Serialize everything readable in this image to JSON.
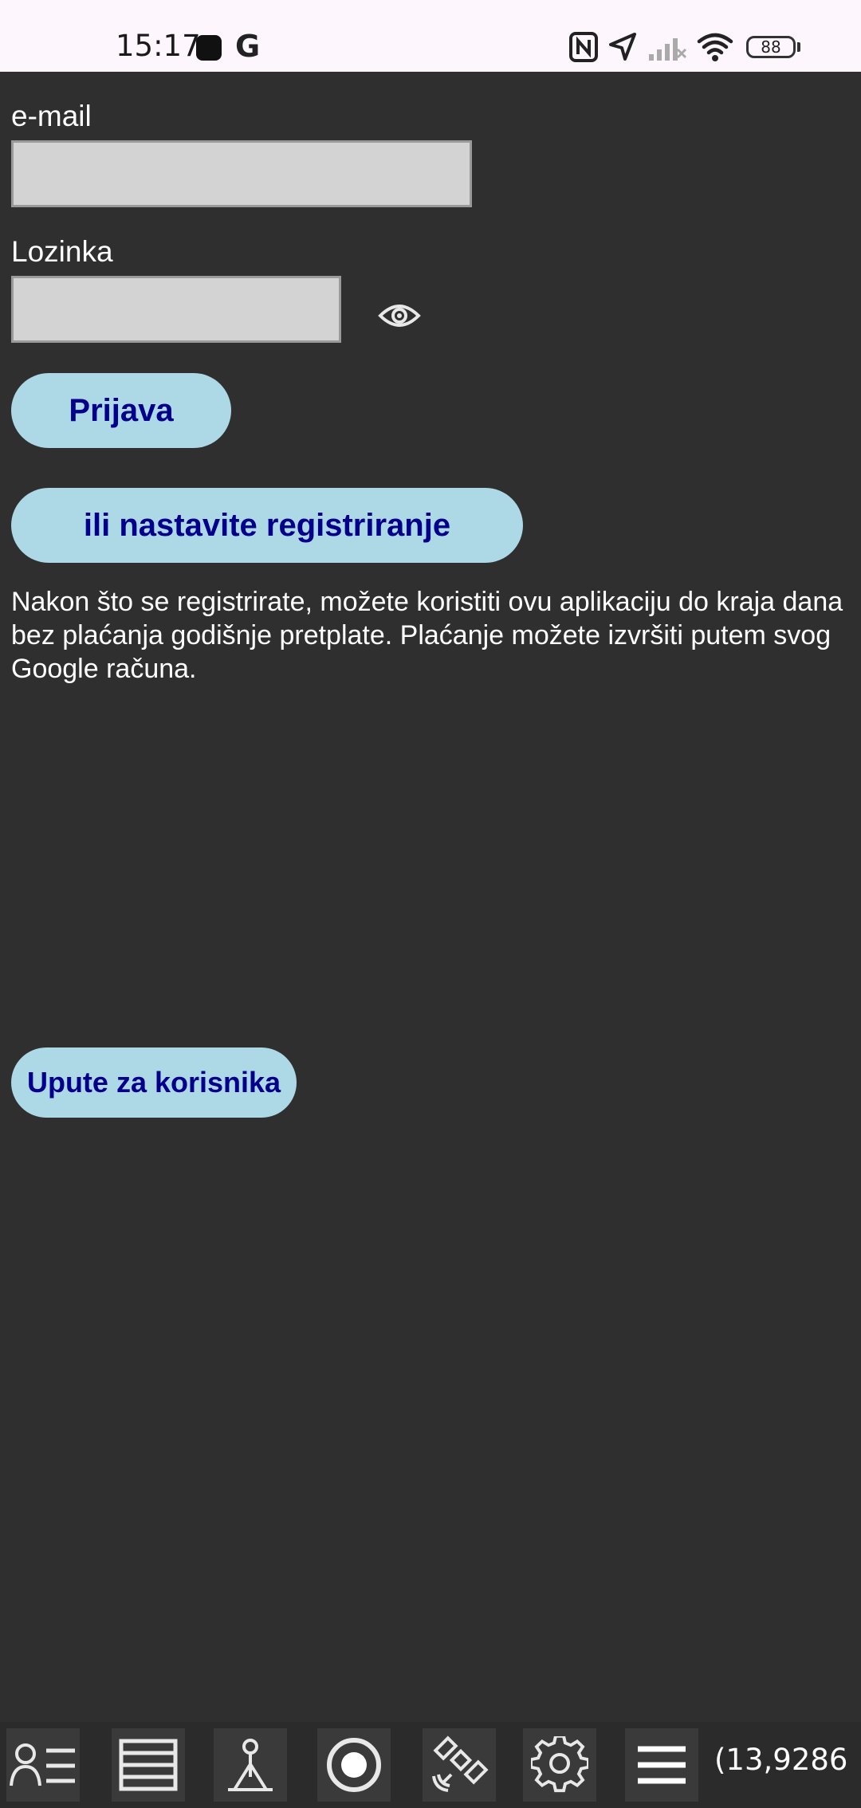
{
  "status_bar": {
    "time": "15:17",
    "g_glyph": "G",
    "battery": "88",
    "icons": [
      "nfc-icon",
      "location-arrow-icon",
      "signal-off-icon",
      "wifi-icon",
      "battery-icon"
    ]
  },
  "form": {
    "email_label": "e-mail",
    "email_value": "",
    "password_label": "Lozinka",
    "password_value": "",
    "login_button": "Prijava",
    "register_button": "ili nastavite registriranje",
    "info": "Nakon što se registrirate, možete koristiti ovu aplikaciju do kraja dana bez plaćanja godišnje pretplate. Plaćanje možete izvršiti putem svog Google računa.",
    "manual_button": "Upute za korisnika"
  },
  "toolbar": {
    "icons": [
      "user-list-icon",
      "layers-icon",
      "surveyor-icon",
      "record-icon",
      "satellite-icon",
      "gear-icon",
      "menu-icon"
    ],
    "coordinate": "(13,9286"
  },
  "colors": {
    "background": "#2f2f30",
    "button_bg": "#add8e6",
    "button_text": "#00008b",
    "input_bg": "#d3d3d3"
  }
}
